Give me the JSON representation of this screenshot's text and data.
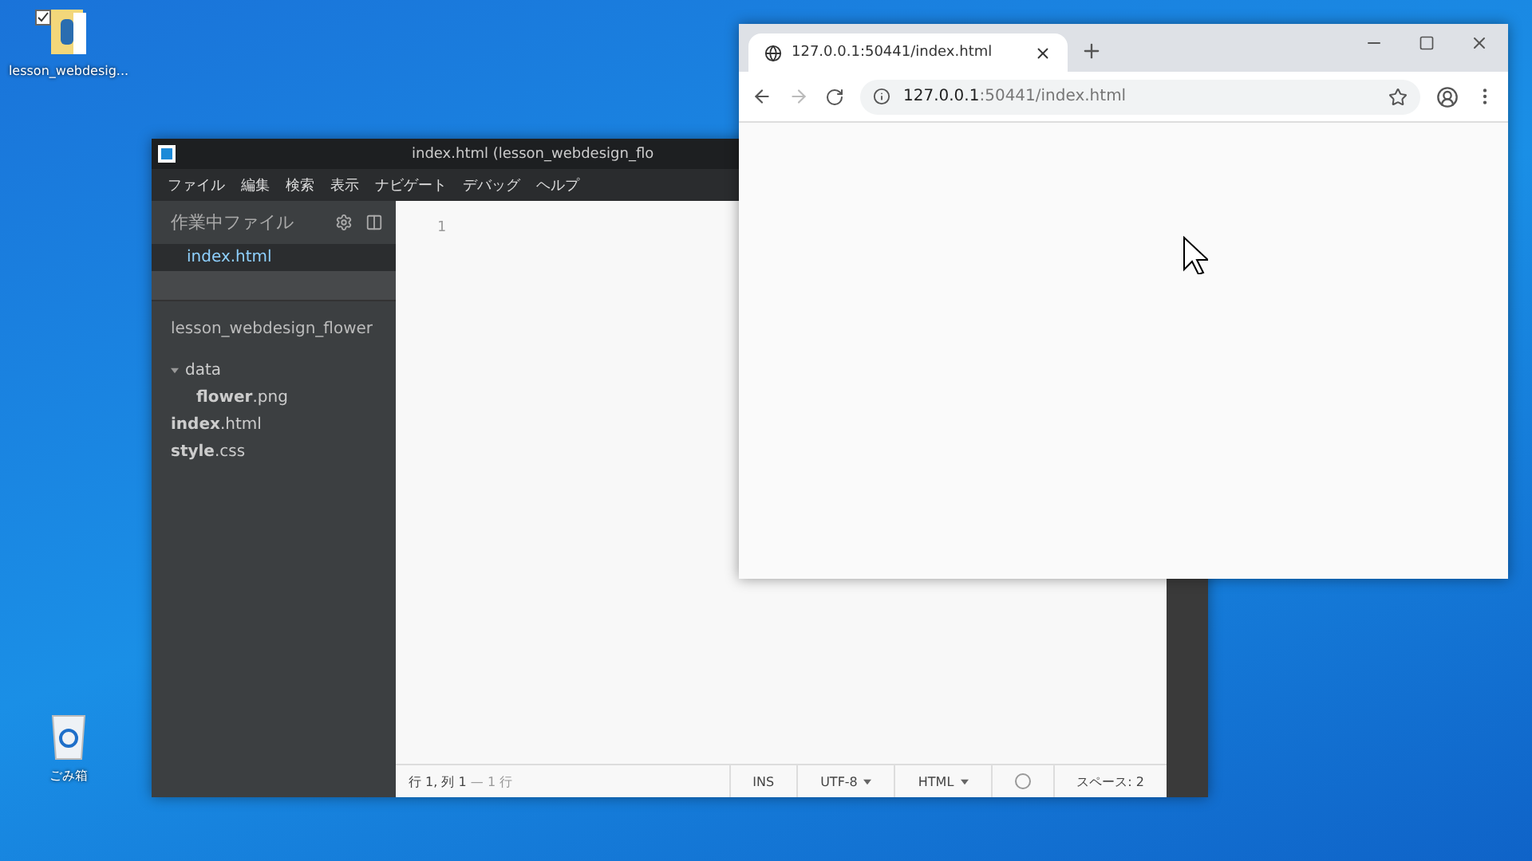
{
  "desktop_icons": [
    {
      "kind": "folder",
      "label": "lesson_webdesig...",
      "checked": true
    },
    {
      "kind": "recycle",
      "label": "ごみ箱",
      "checked": false
    }
  ],
  "editor": {
    "title": "index.html (lesson_webdesign_flo",
    "menu": [
      "ファイル",
      "編集",
      "検索",
      "表示",
      "ナビゲート",
      "デバッグ",
      "ヘルプ"
    ],
    "working_files": {
      "title": "作業中ファイル",
      "items": [
        {
          "label": "index.html",
          "selected": true
        }
      ]
    },
    "project": {
      "name": "lesson_webdesign_flower",
      "tree": [
        {
          "label": "data",
          "expanded": true,
          "children": [
            {
              "label": "**flower**.png"
            }
          ]
        },
        {
          "label": "**index**.html"
        },
        {
          "label": "**style**.css"
        }
      ]
    },
    "line_numbers": [
      "1"
    ],
    "status_bar": {
      "position": "行 1, 列 1",
      "lines": "— 1 行",
      "mode": "INS",
      "encoding": "UTF-8",
      "language": "HTML",
      "spaces": "スペース: 2"
    }
  },
  "browser": {
    "tab": {
      "title": "127.0.0.1:50441/index.html",
      "selected": true
    },
    "address": {
      "host": "127.0.0.1",
      "path": ":50441/index.html"
    }
  }
}
